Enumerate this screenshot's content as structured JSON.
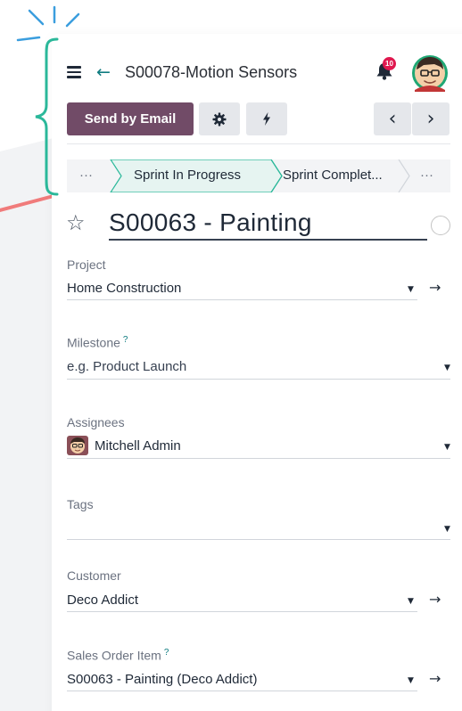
{
  "header": {
    "record_title": "S00078-Motion Sensors",
    "notification_count": "10"
  },
  "toolbar": {
    "send_email_label": "Send by Email"
  },
  "statusbar": {
    "left_ellipsis": "···",
    "current_stage": "Sprint In Progress",
    "next_stage": "Sprint Complet...",
    "right_ellipsis": "···"
  },
  "task": {
    "name": "S00063 - Painting"
  },
  "fields": {
    "project": {
      "label": "Project",
      "value": "Home Construction"
    },
    "milestone": {
      "label": "Milestone",
      "help": "?",
      "placeholder": "e.g. Product Launch"
    },
    "assignees": {
      "label": "Assignees",
      "value": "Mitchell Admin"
    },
    "tags": {
      "label": "Tags"
    },
    "customer": {
      "label": "Customer",
      "value": "Deco Addict"
    },
    "sales_order_item": {
      "label": "Sales Order Item",
      "help": "?",
      "value": "S00063 - Painting (Deco Addict)"
    }
  },
  "colors": {
    "primary": "#714b67",
    "accent": "#0f7c80",
    "badge": "#e0184f",
    "brace": "#2bb89a",
    "decor_line": "#f07b7b"
  }
}
